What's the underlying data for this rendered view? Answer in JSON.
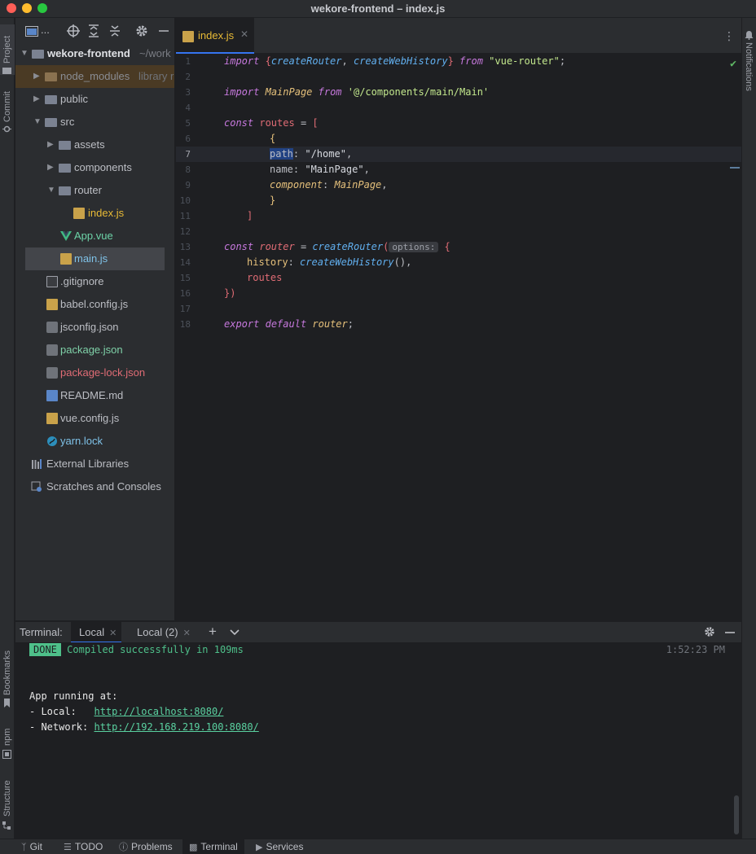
{
  "window": {
    "title": "wekore-frontend – index.js"
  },
  "left_strip": {
    "project": "Project",
    "commit": "Commit",
    "bookmarks": "Bookmarks",
    "npm": "npm",
    "structure": "Structure"
  },
  "right_strip": {
    "notifications": "Notifications"
  },
  "project_toolbar": {
    "view_label": "..."
  },
  "tree": [
    {
      "label": "wekore-frontend",
      "suffix": "~/work",
      "bold": true,
      "color": "#dfe1e5"
    },
    {
      "label": "node_modules",
      "suffix": "library r",
      "color": "#8a8d94"
    },
    {
      "label": "public",
      "color": "#bcbec4"
    },
    {
      "label": "src",
      "color": "#bcbec4"
    },
    {
      "label": "assets",
      "color": "#bcbec4"
    },
    {
      "label": "components",
      "color": "#bcbec4"
    },
    {
      "label": "router",
      "color": "#bcbec4"
    },
    {
      "label": "index.js",
      "color": "#e8ba36"
    },
    {
      "label": "App.vue",
      "color": "#6dd3a8"
    },
    {
      "label": "main.js",
      "color": "#7fc2e8"
    },
    {
      "label": ".gitignore",
      "color": "#bcbec4"
    },
    {
      "label": "babel.config.js",
      "color": "#bcbec4"
    },
    {
      "label": "jsconfig.json",
      "color": "#bcbec4"
    },
    {
      "label": "package.json",
      "color": "#7fd1a8"
    },
    {
      "label": "package-lock.json",
      "color": "#e06c75"
    },
    {
      "label": "README.md",
      "color": "#bcbec4"
    },
    {
      "label": "vue.config.js",
      "color": "#bcbec4"
    },
    {
      "label": "yarn.lock",
      "color": "#7fc2e8"
    },
    {
      "label": "External Libraries",
      "color": "#bcbec4"
    },
    {
      "label": "Scratches and Consoles",
      "color": "#bcbec4"
    }
  ],
  "editor": {
    "tab_label": "index.js",
    "current_line": 7,
    "line_numbers": [
      "1",
      "2",
      "3",
      "4",
      "5",
      "6",
      "7",
      "8",
      "9",
      "10",
      "11",
      "12",
      "13",
      "14",
      "15",
      "16",
      "17",
      "18"
    ],
    "tokens": {
      "l1": [
        "import",
        " {",
        "createRouter",
        ", ",
        "createWebHistory",
        "} ",
        "from",
        " \"vue-router\"",
        ";"
      ],
      "l3": [
        "import",
        " ",
        "MainPage",
        " ",
        "from",
        " '@/components/main/Main'"
      ],
      "l5": [
        "const",
        " ",
        "routes",
        " = ",
        "["
      ],
      "l6": [
        "{"
      ],
      "l7": [
        "path",
        ": ",
        "\"/home\"",
        ","
      ],
      "l8": [
        "name",
        ": ",
        "\"MainPage\"",
        ","
      ],
      "l9": [
        "component",
        ": ",
        "MainPage",
        ","
      ],
      "l10": [
        "}"
      ],
      "l11": [
        "]"
      ],
      "l13": [
        "const",
        " ",
        "router",
        " = ",
        "createRouter",
        "(",
        "options:",
        " {"
      ],
      "l14": [
        "history",
        ": ",
        "createWebHistory",
        "(),"
      ],
      "l15": [
        "routes"
      ],
      "l16": [
        "})"
      ],
      "l18": [
        "export",
        " ",
        "default",
        " ",
        "router",
        ";"
      ]
    }
  },
  "terminal": {
    "label": "Terminal:",
    "tabs": [
      "Local",
      "Local (2)"
    ],
    "done_badge": "DONE",
    "compiled_msg": "Compiled successfully in 109ms",
    "timestamp": "1:52:23 PM",
    "app_running": "App running at:",
    "local_label": "- Local:   ",
    "local_url": "http://localhost:8080/",
    "network_label": "- Network: ",
    "network_url": "http://192.168.219.100:8080/"
  },
  "statusbar": {
    "git": "Git",
    "todo": "TODO",
    "problems": "Problems",
    "terminal": "Terminal",
    "services": "Services"
  },
  "colors": {
    "accent": "#3574f0",
    "done_green": "#4ec08a",
    "folder": "#7b8291"
  }
}
